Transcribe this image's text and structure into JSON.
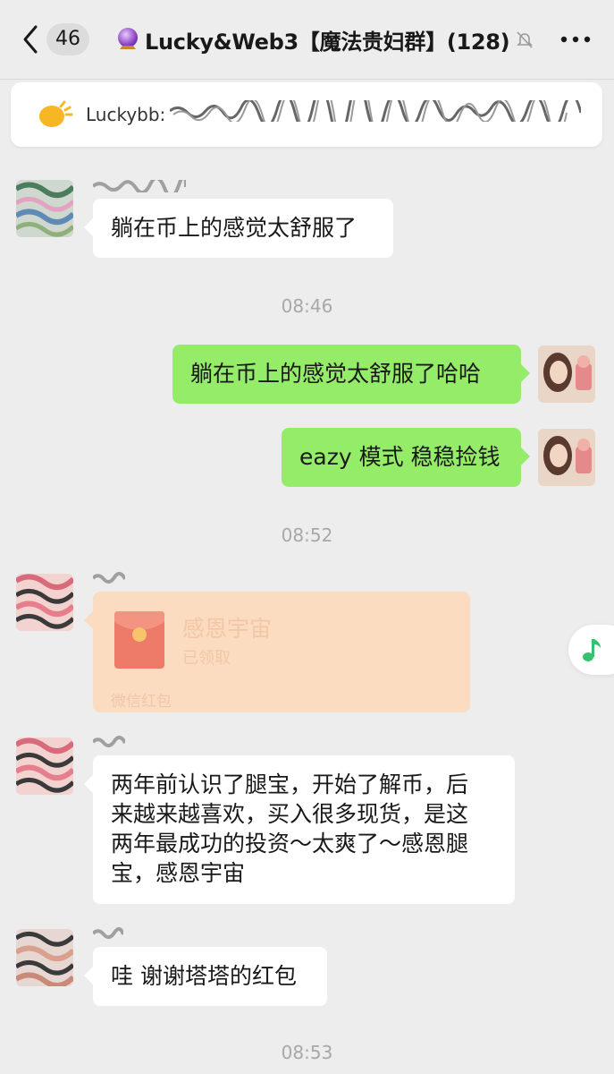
{
  "header": {
    "unread_count": "46",
    "title": "Lucky&Web3【魔法贵妇群】(128)",
    "icons": {
      "back": "chevron-left-icon",
      "orb": "crystal-ball-icon",
      "mute": "bell-muted-icon",
      "more": "more-dots-icon"
    }
  },
  "notice": {
    "sender": "Luckybb:",
    "icon": "announcement-bulb-icon"
  },
  "messages": [
    {
      "side": "left",
      "text": "躺在币上的感觉太舒服了"
    },
    {
      "type": "time",
      "text": "08:46"
    },
    {
      "side": "right",
      "text": "躺在币上的感觉太舒服了哈哈"
    },
    {
      "side": "right",
      "text": "eazy 模式 稳稳捡钱"
    },
    {
      "type": "time",
      "text": "08:52"
    },
    {
      "side": "left",
      "type": "red_packet",
      "title": "感恩宇宙",
      "status": "已领取",
      "label": "微信红包"
    },
    {
      "side": "left",
      "lines": [
        "两年前认识了腿宝，开始了解币，后",
        "来越来越喜欢，买入很多现货，是这",
        "两年最成功的投资～太爽了～感恩腿",
        "宝，感恩宇宙"
      ]
    },
    {
      "side": "left",
      "text": "哇 谢谢塔塔的红包"
    },
    {
      "type": "time",
      "text": "08:53"
    }
  ],
  "floating": {
    "icon": "music-note-icon"
  },
  "colors": {
    "background": "#ededed",
    "bubble_self": "#95ec69",
    "bubble_other": "#ffffff",
    "red_packet_bg": "#fbdcc0",
    "timestamp": "#a8a8a8"
  }
}
